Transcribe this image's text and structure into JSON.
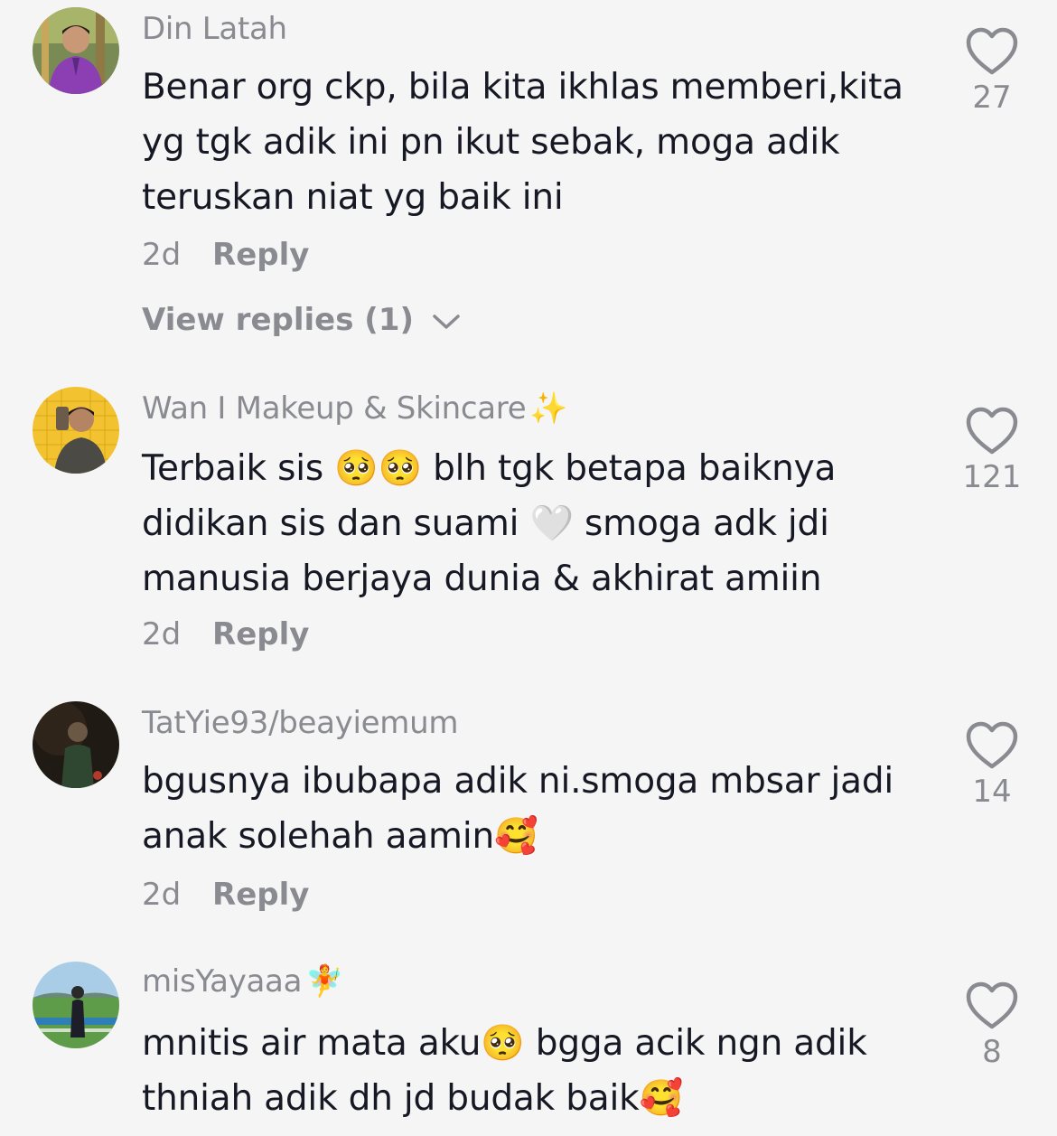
{
  "comments": [
    {
      "username": "Din Latah",
      "badge": "",
      "text": "Benar org ckp, bila kita ikhlas memberi,kita yg tgk adik ini pn ikut sebak, moga adik teruskan niat yg baik ini",
      "time": "2d",
      "reply_label": "Reply",
      "view_replies": "View replies (1)",
      "likes": "27",
      "avatar_icon": "avatar-man-purple-shirt"
    },
    {
      "username": "Wan I Makeup & Skincare",
      "badge": "✨",
      "text": "Terbaik sis 🥺🥺 blh tgk betapa baiknya didikan sis dan suami 🤍 smoga adk jdi manusia berjaya dunia & akhirat amiin",
      "time": "2d",
      "reply_label": "Reply",
      "likes": "121",
      "avatar_icon": "avatar-selfie-yellow"
    },
    {
      "username": "TatYie93/beayiemum",
      "badge": "",
      "text": "bgusnya ibubapa adik ni.smoga mbsar jadi anak solehah aamin🥰",
      "time": "2d",
      "reply_label": "Reply",
      "likes": "14",
      "avatar_icon": "avatar-dark-figure"
    },
    {
      "username": "misYayaaa",
      "badge": "🧚",
      "text": "mnitis air mata aku🥺 bgga acik ngn adik thniah adik dh jd budak baik🥰",
      "likes": "8",
      "avatar_icon": "avatar-landscape-person"
    }
  ],
  "colors": {
    "background": "#f5f5f6",
    "text": "#161823",
    "muted": "#8a8b91"
  },
  "icons": {
    "like": "heart-outline-icon",
    "expand": "chevron-down-icon"
  }
}
